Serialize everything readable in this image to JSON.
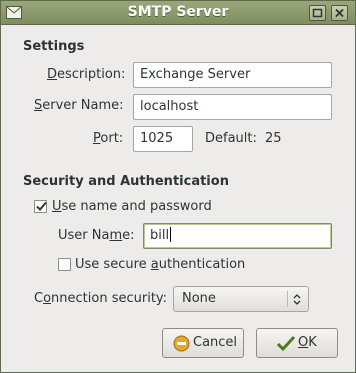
{
  "window": {
    "title": "SMTP Server"
  },
  "settings": {
    "heading": "Settings",
    "description": {
      "label_u": "D",
      "label_rest": "escription:",
      "value": "Exchange Server"
    },
    "server_name": {
      "label_u": "S",
      "label_rest": "erver Name:",
      "value": "localhost"
    },
    "port": {
      "label_u": "P",
      "label_rest": "ort:",
      "value": "1025",
      "default_label": "Default:",
      "default_value": "25"
    }
  },
  "security": {
    "heading": "Security and Authentication",
    "use_name": {
      "label_u": "U",
      "label_rest": "se name and password",
      "checked": true
    },
    "user_name": {
      "label_pre": "User Na",
      "label_u": "m",
      "label_rest": "e:",
      "value": "bill"
    },
    "secure_auth": {
      "label_pre": "Use secure ",
      "label_u": "a",
      "label_rest": "uthentication",
      "checked": false
    },
    "connection": {
      "label_pre": "C",
      "label_u": "o",
      "label_rest": "nnection security:",
      "selected": "None"
    }
  },
  "buttons": {
    "cancel": "Cancel",
    "ok_u": "O",
    "ok_rest": "K"
  },
  "icons": {
    "app": "envelope-icon",
    "maximize": "maximize-icon",
    "close": "close-icon",
    "check": "checkmark-icon",
    "combo": "combo-arrows-icon",
    "cancel": "cancel-icon",
    "ok": "ok-check-icon"
  }
}
